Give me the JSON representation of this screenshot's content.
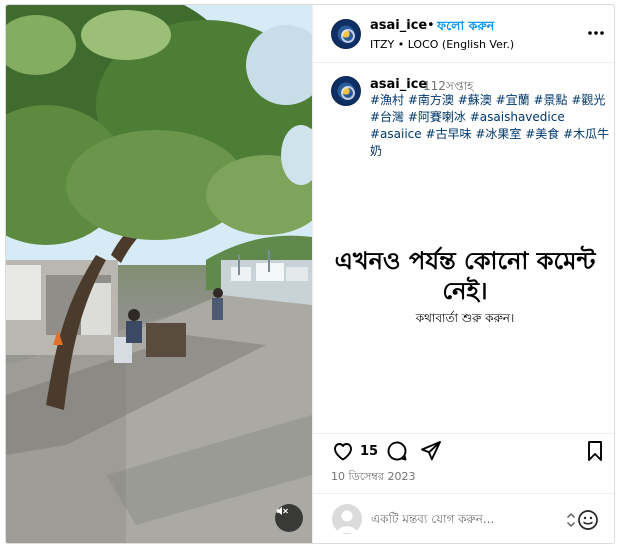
{
  "header": {
    "username": "asai_ice",
    "separator": "•",
    "follow_label": "ফলো করুন",
    "song": "ITZY • LOCO (English Ver.)"
  },
  "caption": {
    "username": "asai_ice",
    "time": "112সপ্তাহ",
    "hashtags": "#漁村 #南方澳 #蘇澳 #宜蘭 #景點 #觀光 #台灣 #阿賽喇冰 #asaishavedice #asaiice #古早味 #冰果室 #美食 #木瓜牛奶"
  },
  "comments": {
    "empty_title": "এখনও পর্যন্ত কোনো কমেন্ট নেই।",
    "empty_subtitle": "কথাবার্তা শুরু করুন।"
  },
  "actions": {
    "like_count": "15",
    "date": "10 ডিসেম্বর 2023"
  },
  "comment_box": {
    "placeholder": "একটি মন্তব্য যোগ করুন..."
  },
  "icons": {
    "more": "more-options-icon",
    "like": "heart-icon",
    "comment": "comment-bubble-icon",
    "share": "paper-plane-icon",
    "save": "bookmark-icon",
    "mute": "speaker-muted-icon",
    "emoji": "emoji-icon"
  },
  "colors": {
    "link_blue": "#0095f6",
    "hashtag_blue": "#00376b",
    "muted_gray": "#737373"
  }
}
